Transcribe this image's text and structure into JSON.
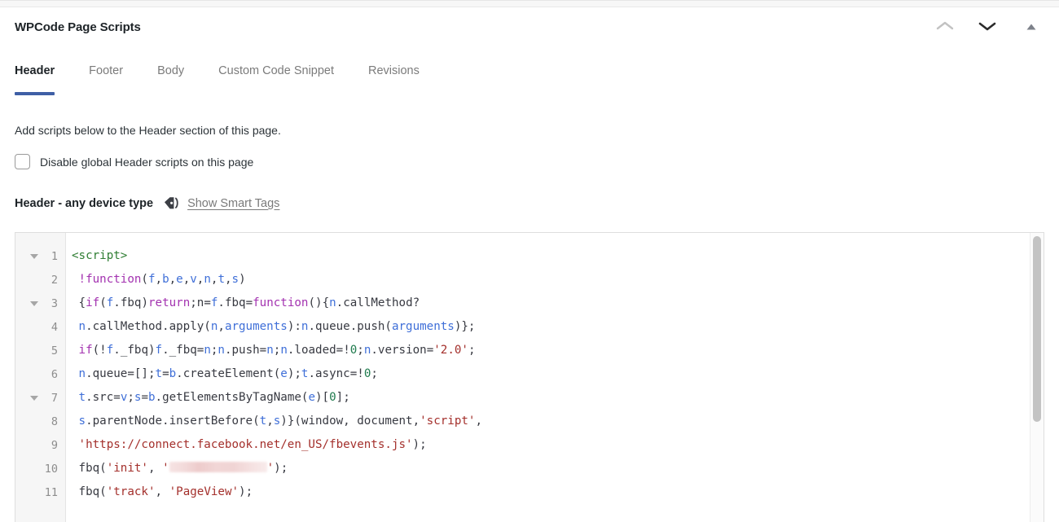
{
  "panel": {
    "title": "WPCode Page Scripts",
    "actions": [
      {
        "name": "move-up-icon",
        "glyph": "chevron-up"
      },
      {
        "name": "move-down-icon",
        "glyph": "chevron-down"
      },
      {
        "name": "collapse-panel-icon",
        "glyph": "triangle-up"
      }
    ]
  },
  "tabs": [
    {
      "label": "Header",
      "active": true
    },
    {
      "label": "Footer",
      "active": false
    },
    {
      "label": "Body",
      "active": false
    },
    {
      "label": "Custom Code Snippet",
      "active": false
    },
    {
      "label": "Revisions",
      "active": false
    }
  ],
  "description": "Add scripts below to the Header section of this page.",
  "checkbox": {
    "label": "Disable global Header scripts on this page",
    "checked": false
  },
  "field": {
    "label": "Header - any device type",
    "smart_tags_link": "Show Smart Tags",
    "tag_icon": "tag-icon"
  },
  "editor": {
    "lines": [
      {
        "n": "1",
        "fold": true,
        "tokens": [
          {
            "t": "tag",
            "v": "<script>"
          }
        ]
      },
      {
        "n": "2",
        "fold": false,
        "tokens": [
          {
            "t": "plain",
            "v": " "
          },
          {
            "t": "kw",
            "v": "!function"
          },
          {
            "t": "plain",
            "v": "("
          },
          {
            "t": "var",
            "v": "f"
          },
          {
            "t": "plain",
            "v": ","
          },
          {
            "t": "var",
            "v": "b"
          },
          {
            "t": "plain",
            "v": ","
          },
          {
            "t": "var",
            "v": "e"
          },
          {
            "t": "plain",
            "v": ","
          },
          {
            "t": "var",
            "v": "v"
          },
          {
            "t": "plain",
            "v": ","
          },
          {
            "t": "var",
            "v": "n"
          },
          {
            "t": "plain",
            "v": ","
          },
          {
            "t": "var",
            "v": "t"
          },
          {
            "t": "plain",
            "v": ","
          },
          {
            "t": "var",
            "v": "s"
          },
          {
            "t": "plain",
            "v": ")"
          }
        ]
      },
      {
        "n": "3",
        "fold": true,
        "tokens": [
          {
            "t": "plain",
            "v": " {"
          },
          {
            "t": "kw",
            "v": "if"
          },
          {
            "t": "plain",
            "v": "("
          },
          {
            "t": "var",
            "v": "f"
          },
          {
            "t": "plain",
            "v": ".fbq)"
          },
          {
            "t": "kw",
            "v": "return"
          },
          {
            "t": "plain",
            "v": ";n="
          },
          {
            "t": "var",
            "v": "f"
          },
          {
            "t": "plain",
            "v": ".fbq="
          },
          {
            "t": "kw",
            "v": "function"
          },
          {
            "t": "plain",
            "v": "(){"
          },
          {
            "t": "var",
            "v": "n"
          },
          {
            "t": "plain",
            "v": ".callMethod?"
          }
        ]
      },
      {
        "n": "4",
        "fold": false,
        "tokens": [
          {
            "t": "plain",
            "v": " "
          },
          {
            "t": "var",
            "v": "n"
          },
          {
            "t": "plain",
            "v": ".callMethod.apply("
          },
          {
            "t": "var",
            "v": "n"
          },
          {
            "t": "plain",
            "v": ","
          },
          {
            "t": "var",
            "v": "arguments"
          },
          {
            "t": "plain",
            "v": "):"
          },
          {
            "t": "var",
            "v": "n"
          },
          {
            "t": "plain",
            "v": ".queue.push("
          },
          {
            "t": "var",
            "v": "arguments"
          },
          {
            "t": "plain",
            "v": ")};"
          }
        ]
      },
      {
        "n": "5",
        "fold": false,
        "tokens": [
          {
            "t": "plain",
            "v": " "
          },
          {
            "t": "kw",
            "v": "if"
          },
          {
            "t": "plain",
            "v": "(!"
          },
          {
            "t": "var",
            "v": "f"
          },
          {
            "t": "plain",
            "v": "._fbq)"
          },
          {
            "t": "var",
            "v": "f"
          },
          {
            "t": "plain",
            "v": "._fbq="
          },
          {
            "t": "var",
            "v": "n"
          },
          {
            "t": "plain",
            "v": ";"
          },
          {
            "t": "var",
            "v": "n"
          },
          {
            "t": "plain",
            "v": ".push="
          },
          {
            "t": "var",
            "v": "n"
          },
          {
            "t": "plain",
            "v": ";"
          },
          {
            "t": "var",
            "v": "n"
          },
          {
            "t": "plain",
            "v": ".loaded=!"
          },
          {
            "t": "num",
            "v": "0"
          },
          {
            "t": "plain",
            "v": ";"
          },
          {
            "t": "var",
            "v": "n"
          },
          {
            "t": "plain",
            "v": ".version="
          },
          {
            "t": "str",
            "v": "'2.0'"
          },
          {
            "t": "plain",
            "v": ";"
          }
        ]
      },
      {
        "n": "6",
        "fold": false,
        "tokens": [
          {
            "t": "plain",
            "v": " "
          },
          {
            "t": "var",
            "v": "n"
          },
          {
            "t": "plain",
            "v": ".queue=[];"
          },
          {
            "t": "var",
            "v": "t"
          },
          {
            "t": "plain",
            "v": "="
          },
          {
            "t": "var",
            "v": "b"
          },
          {
            "t": "plain",
            "v": ".createElement("
          },
          {
            "t": "var",
            "v": "e"
          },
          {
            "t": "plain",
            "v": ");"
          },
          {
            "t": "var",
            "v": "t"
          },
          {
            "t": "plain",
            "v": ".async=!"
          },
          {
            "t": "num",
            "v": "0"
          },
          {
            "t": "plain",
            "v": ";"
          }
        ]
      },
      {
        "n": "7",
        "fold": true,
        "tokens": [
          {
            "t": "plain",
            "v": " "
          },
          {
            "t": "var",
            "v": "t"
          },
          {
            "t": "plain",
            "v": ".src="
          },
          {
            "t": "var",
            "v": "v"
          },
          {
            "t": "plain",
            "v": ";"
          },
          {
            "t": "var",
            "v": "s"
          },
          {
            "t": "plain",
            "v": "="
          },
          {
            "t": "var",
            "v": "b"
          },
          {
            "t": "plain",
            "v": ".getElementsByTagName("
          },
          {
            "t": "var",
            "v": "e"
          },
          {
            "t": "plain",
            "v": ")["
          },
          {
            "t": "num",
            "v": "0"
          },
          {
            "t": "plain",
            "v": "];"
          }
        ]
      },
      {
        "n": "8",
        "fold": false,
        "tokens": [
          {
            "t": "plain",
            "v": " "
          },
          {
            "t": "var",
            "v": "s"
          },
          {
            "t": "plain",
            "v": ".parentNode.insertBefore("
          },
          {
            "t": "var",
            "v": "t"
          },
          {
            "t": "plain",
            "v": ","
          },
          {
            "t": "var",
            "v": "s"
          },
          {
            "t": "plain",
            "v": ")}(window, document,"
          },
          {
            "t": "str",
            "v": "'script'"
          },
          {
            "t": "plain",
            "v": ","
          }
        ]
      },
      {
        "n": "9",
        "fold": false,
        "tokens": [
          {
            "t": "plain",
            "v": " "
          },
          {
            "t": "str",
            "v": "'https://connect.facebook.net/en_US/fbevents.js'"
          },
          {
            "t": "plain",
            "v": ");"
          }
        ]
      },
      {
        "n": "10",
        "fold": false,
        "tokens": [
          {
            "t": "plain",
            "v": " fbq("
          },
          {
            "t": "str",
            "v": "'init'"
          },
          {
            "t": "plain",
            "v": ", "
          },
          {
            "t": "str",
            "v": "'"
          },
          {
            "t": "redacted",
            "v": ""
          },
          {
            "t": "str",
            "v": "'"
          },
          {
            "t": "plain",
            "v": ");"
          }
        ]
      },
      {
        "n": "11",
        "fold": false,
        "tokens": [
          {
            "t": "plain",
            "v": " fbq("
          },
          {
            "t": "str",
            "v": "'track'"
          },
          {
            "t": "plain",
            "v": ", "
          },
          {
            "t": "str",
            "v": "'PageView'"
          },
          {
            "t": "plain",
            "v": ");"
          }
        ]
      }
    ]
  },
  "colors": {
    "accent_blue": "#3f5fa5",
    "tag_green": "#2e7d32",
    "keyword_purple": "#a332b0",
    "variable_blue": "#3f6fd8",
    "string_red": "#a4302c",
    "number_green": "#1f7a4d"
  }
}
